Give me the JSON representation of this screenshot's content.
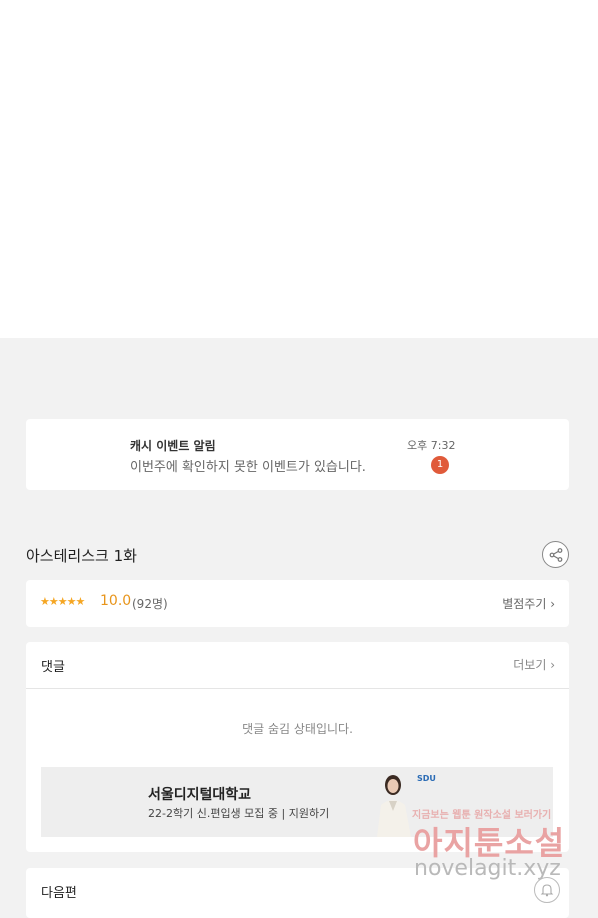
{
  "notification": {
    "title": "캐시 이벤트 알림",
    "message": "이번주에 확인하지 못한 이벤트가 있습니다.",
    "time": "오후 7:32",
    "badge_count": "1"
  },
  "episode": {
    "title": "아스테리스크 1화",
    "share_icon": "share-icon"
  },
  "rating": {
    "stars": "★★★★★",
    "score": "10.0",
    "count": "(92명)",
    "rate_label": "별점주기 ›"
  },
  "comments": {
    "header": "댓글",
    "more_label": "더보기 ›",
    "hidden_message": "댓글 숨김 상태입니다."
  },
  "ad": {
    "title": "서울디지털대학교",
    "subtitle": "22-2학기 신.편입생 모집 중 | 지원하기",
    "logo": "SDU"
  },
  "next": {
    "label": "다음편"
  },
  "watermark": {
    "top": "지금보는 웹툰 원작소설 보러가기",
    "brand": "아지툰소설",
    "url": "novelagit.xyz"
  },
  "colors": {
    "accent_star": "#f5a623",
    "score": "#e8951b",
    "badge": "#e05a3a"
  }
}
